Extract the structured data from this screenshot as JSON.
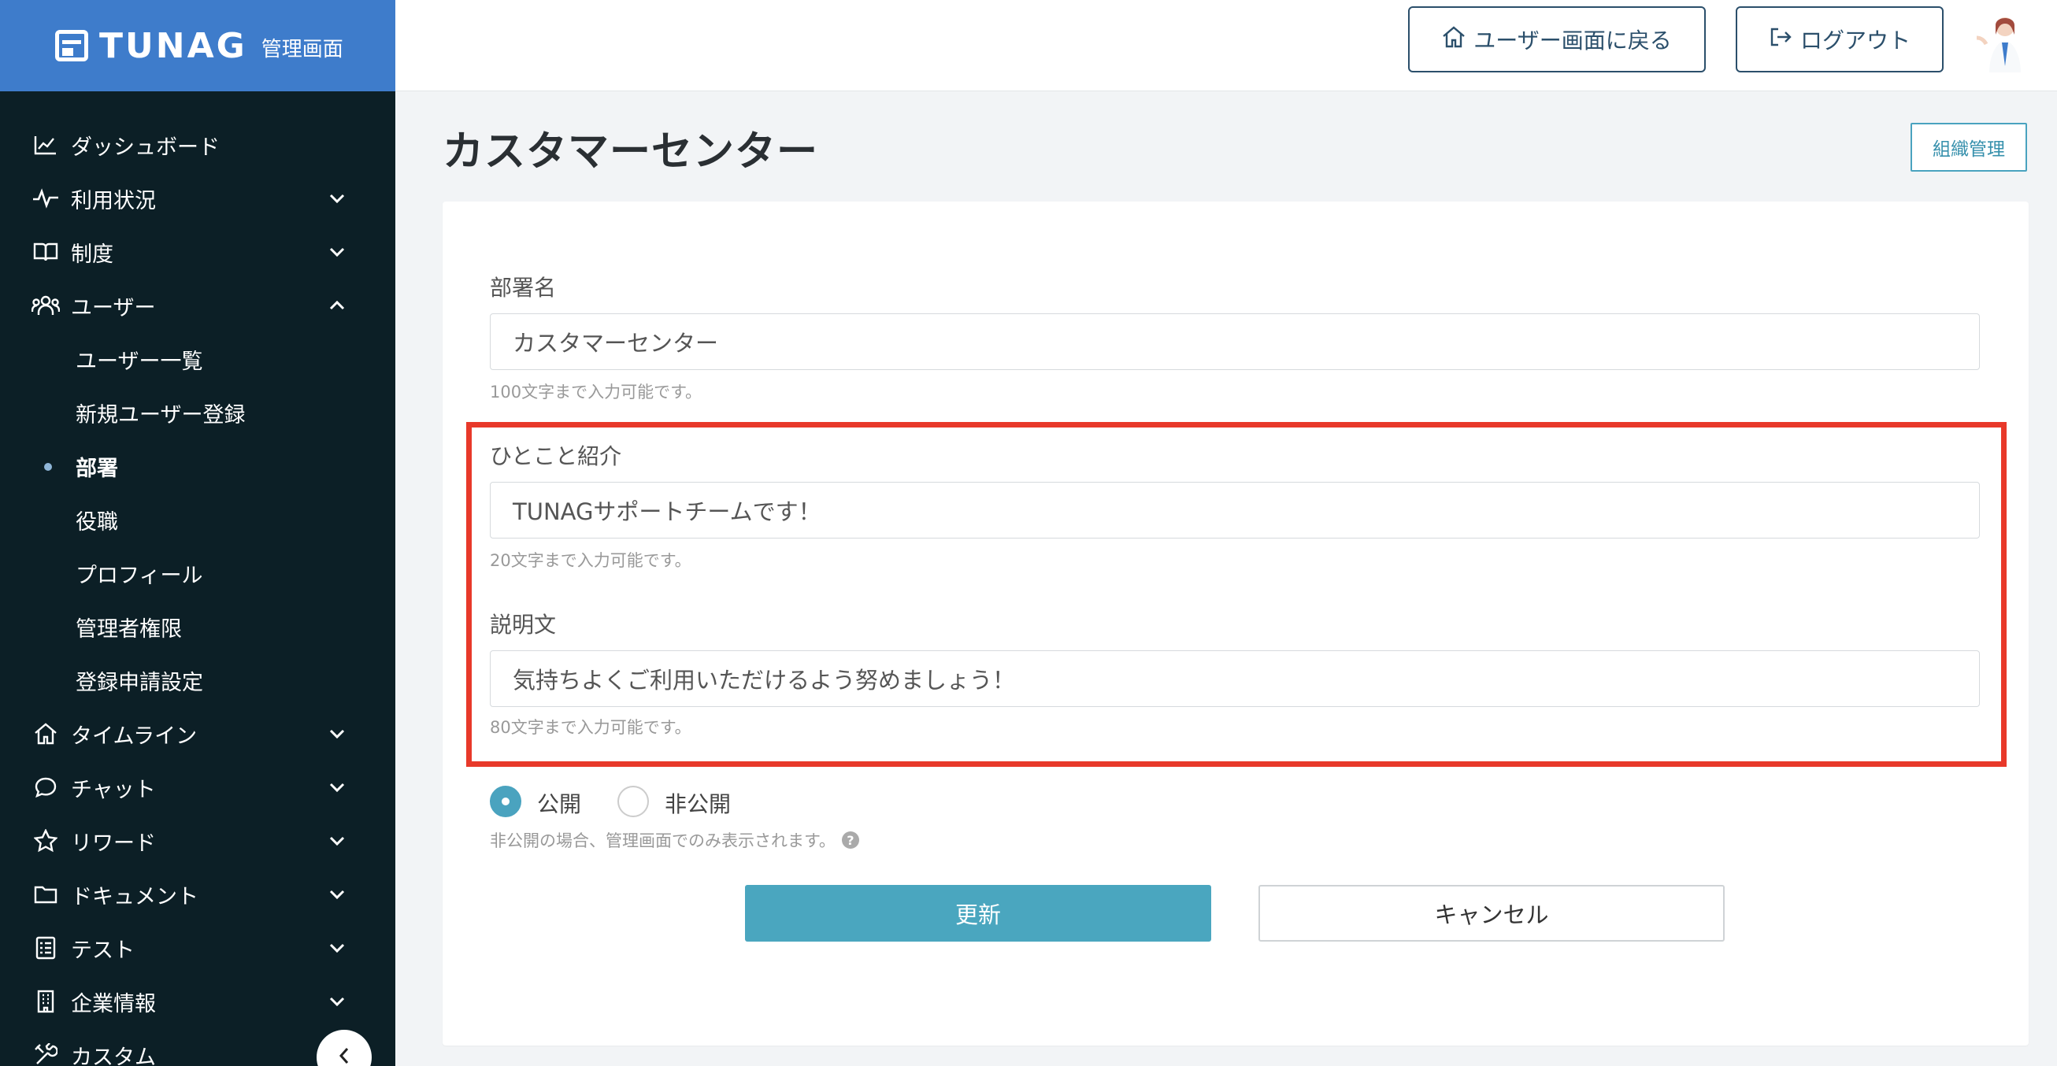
{
  "brand": {
    "name": "TUNAG",
    "subtitle": "管理画面"
  },
  "header": {
    "user_screen_label": "ユーザー画面に戻る",
    "logout_label": "ログアウト"
  },
  "sidebar": {
    "items": [
      {
        "label": "ダッシュボード",
        "icon": "chart-line-icon"
      },
      {
        "label": "利用状況",
        "icon": "activity-icon",
        "expandable": true
      },
      {
        "label": "制度",
        "icon": "book-icon",
        "expandable": true
      },
      {
        "label": "ユーザー",
        "icon": "users-icon",
        "expanded": true
      },
      {
        "label": "タイムライン",
        "icon": "home-icon",
        "expandable": true
      },
      {
        "label": "チャット",
        "icon": "chat-bubble-icon",
        "expandable": true
      },
      {
        "label": "リワード",
        "icon": "star-icon",
        "expandable": true
      },
      {
        "label": "ドキュメント",
        "icon": "folder-icon",
        "expandable": true
      },
      {
        "label": "テスト",
        "icon": "checklist-icon",
        "expandable": true
      },
      {
        "label": "企業情報",
        "icon": "building-icon",
        "expandable": true
      },
      {
        "label": "カスタム",
        "icon": "tools-icon"
      }
    ],
    "user_sub_items": [
      "ユーザー一覧",
      "新規ユーザー登録",
      "部署",
      "役職",
      "プロフィール",
      "管理者権限",
      "登録申請設定"
    ],
    "active_sub_item": "部署"
  },
  "page": {
    "title": "カスタマーセンター",
    "org_button_label": "組織管理"
  },
  "form": {
    "dept_name": {
      "label": "部署名",
      "value": "カスタマーセンター",
      "hint": "100文字まで入力可能です。"
    },
    "intro": {
      "label": "ひとこと紹介",
      "value": "TUNAGサポートチームです！",
      "hint": "20文字まで入力可能です。"
    },
    "description": {
      "label": "説明文",
      "value": "気持ちよくご利用いただけるよう努めましょう！",
      "hint": "80文字まで入力可能です。"
    },
    "visibility": {
      "public_label": "公開",
      "private_label": "非公開",
      "selected": "公開",
      "hint": "非公開の場合、管理画面でのみ表示されます。"
    },
    "update_label": "更新",
    "cancel_label": "キャンセル"
  },
  "colors": {
    "brand_blue": "#3e7ccb",
    "sidebar_bg": "#0c1f26",
    "accent_teal": "#4aa6bf",
    "highlight_red": "#e8392a"
  }
}
